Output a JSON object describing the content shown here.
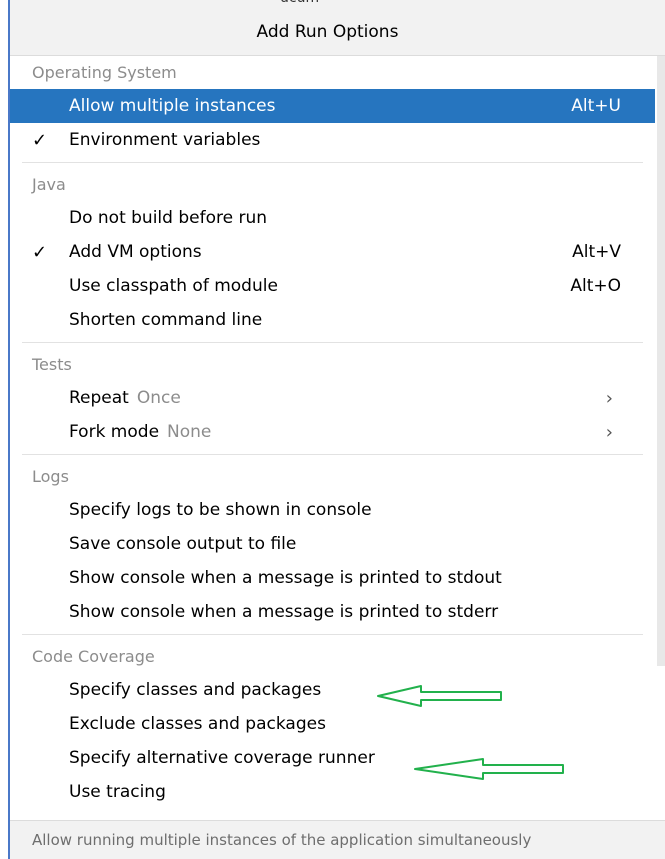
{
  "popup": {
    "title": "Add Run Options",
    "top_text": "ucum"
  },
  "sections": [
    {
      "header": "Operating System",
      "items": [
        {
          "label": "Allow multiple instances",
          "shortcut": "Alt+U",
          "checked": false,
          "selected": true
        },
        {
          "label": "Environment variables",
          "shortcut": "",
          "checked": true,
          "selected": false
        }
      ]
    },
    {
      "header": "Java",
      "items": [
        {
          "label": "Do not build before run",
          "shortcut": "",
          "checked": false
        },
        {
          "label": "Add VM options",
          "shortcut": "Alt+V",
          "checked": true
        },
        {
          "label": "Use classpath of module",
          "shortcut": "Alt+O",
          "checked": false
        },
        {
          "label": "Shorten command line",
          "shortcut": "",
          "checked": false
        }
      ]
    },
    {
      "header": "Tests",
      "items": [
        {
          "label": "Repeat",
          "value": "Once",
          "submenu": true
        },
        {
          "label": "Fork mode",
          "value": "None",
          "submenu": true
        }
      ]
    },
    {
      "header": "Logs",
      "items": [
        {
          "label": "Specify logs to be shown in console"
        },
        {
          "label": "Save console output to file"
        },
        {
          "label": "Show console when a message is printed to stdout"
        },
        {
          "label": "Show console when a message is printed to stderr"
        }
      ]
    },
    {
      "header": "Code Coverage",
      "items": [
        {
          "label": "Specify classes and packages"
        },
        {
          "label": "Exclude classes and packages"
        },
        {
          "label": "Specify alternative coverage runner"
        },
        {
          "label": "Use tracing"
        }
      ]
    }
  ],
  "check_glyph": "✓",
  "chevron_glyph": "›",
  "footer": "Allow running multiple instances of the application simultaneously",
  "colors": {
    "selection": "#2675bf",
    "annotation_arrow": "#22b14c"
  }
}
